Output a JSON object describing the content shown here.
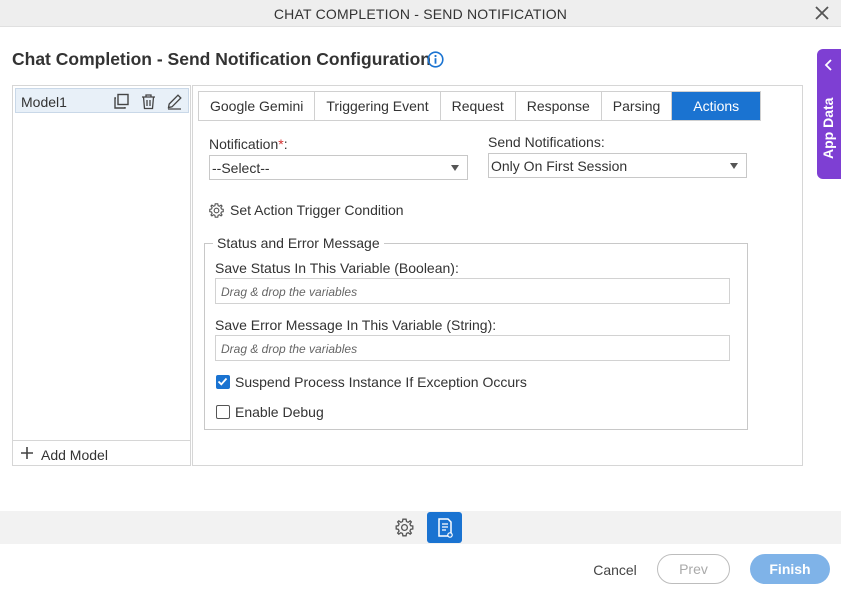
{
  "window": {
    "title": "CHAT COMPLETION - SEND NOTIFICATION",
    "close_icon": "close-icon"
  },
  "page": {
    "heading": "Chat Completion - Send Notification Configuration",
    "info_icon": "info-icon"
  },
  "app_data": {
    "label": "App Data",
    "icon": "chevron-left-icon",
    "color": "#7e3fd3"
  },
  "models": {
    "items": [
      {
        "name": "Model1"
      }
    ],
    "actions": [
      "duplicate-icon",
      "trash-icon",
      "pencil-icon"
    ],
    "add_label": "Add Model"
  },
  "tabs": [
    {
      "label": "Google Gemini",
      "active": false
    },
    {
      "label": "Triggering Event",
      "active": false
    },
    {
      "label": "Request",
      "active": false
    },
    {
      "label": "Response",
      "active": false
    },
    {
      "label": "Parsing",
      "active": false
    },
    {
      "label": "Actions",
      "active": true
    }
  ],
  "form": {
    "notification_label": "Notification",
    "notification_required": "*",
    "notification_colon": ":",
    "notification_value": "--Select--",
    "send_label": "Send Notifications:",
    "send_value": "Only On First Session",
    "trigger_label": "Set Action Trigger Condition",
    "status_group": {
      "legend": "Status and Error Message",
      "status_label": "Save Status In This Variable (Boolean):",
      "status_placeholder": "Drag & drop the variables",
      "error_label": "Save Error Message In This Variable (String):",
      "error_placeholder": "Drag & drop the variables",
      "suspend_label": "Suspend Process Instance If Exception Occurs",
      "suspend_checked": true,
      "debug_label": "Enable Debug",
      "debug_checked": false
    }
  },
  "footer": {
    "cancel": "Cancel",
    "prev": "Prev",
    "finish": "Finish",
    "accent": "#1a73d1"
  }
}
